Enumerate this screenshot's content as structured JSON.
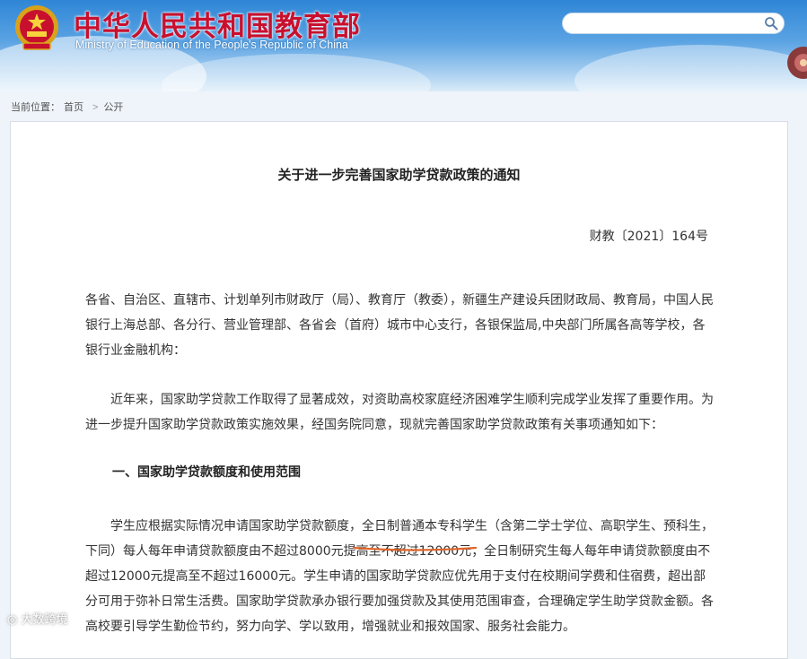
{
  "header": {
    "title_cn": "中华人民共和国教育部",
    "title_en": "Ministry of Education of the People's Republic of China",
    "search_placeholder": "",
    "emblem_icon": "national-emblem-icon",
    "search_icon": "search-icon",
    "brand_color": "#c8102e"
  },
  "breadcrumb": {
    "prefix": "当前位置：",
    "items": [
      "首页",
      "公开"
    ],
    "separator": ">"
  },
  "article": {
    "title": "关于进一步完善国家助学贷款政策的通知",
    "doc_number": "财教〔2021〕164号",
    "recipients": "各省、自治区、直辖市、计划单列市财政厅（局）、教育厅（教委），新疆生产建设兵团财政局、教育局，中国人民银行上海总部、各分行、营业管理部、各省会（首府）城市中心支行，各银保监局,中央部门所属各高等学校，各银行业金融机构：",
    "intro": "近年来，国家助学贷款工作取得了显著成效，对资助高校家庭经济困难学生顺利完成学业发挥了重要作用。为进一步提升国家助学贷款政策实施效果，经国务院同意，现就完善国家助学贷款政策有关事项通知如下：",
    "section1_heading": "一、国家助学贷款额度和使用范围",
    "section1_body": "学生应根据实际情况申请国家助学贷款额度，全日制普通本专科学生（含第二学士学位、高职学生、预科生，下同）每人每年申请贷款额度由不超过8000元提高至不超过12000元；全日制研究生每人每年申请贷款额度由不超过12000元提高至不超过16000元。学生申请的国家助学贷款应优先用于支付在校期间学费和住宿费，超出部分可用于弥补日常生活费。国家助学贷款承办银行要加强贷款及其使用范围审查，合理确定学生助学贷款金额。各高校要引导学生勤俭节约，努力向学、学以致用，增强就业和报效国家、服务社会能力。",
    "highlight_color": "#e0662a"
  },
  "watermark": {
    "text": "大数跨境"
  }
}
